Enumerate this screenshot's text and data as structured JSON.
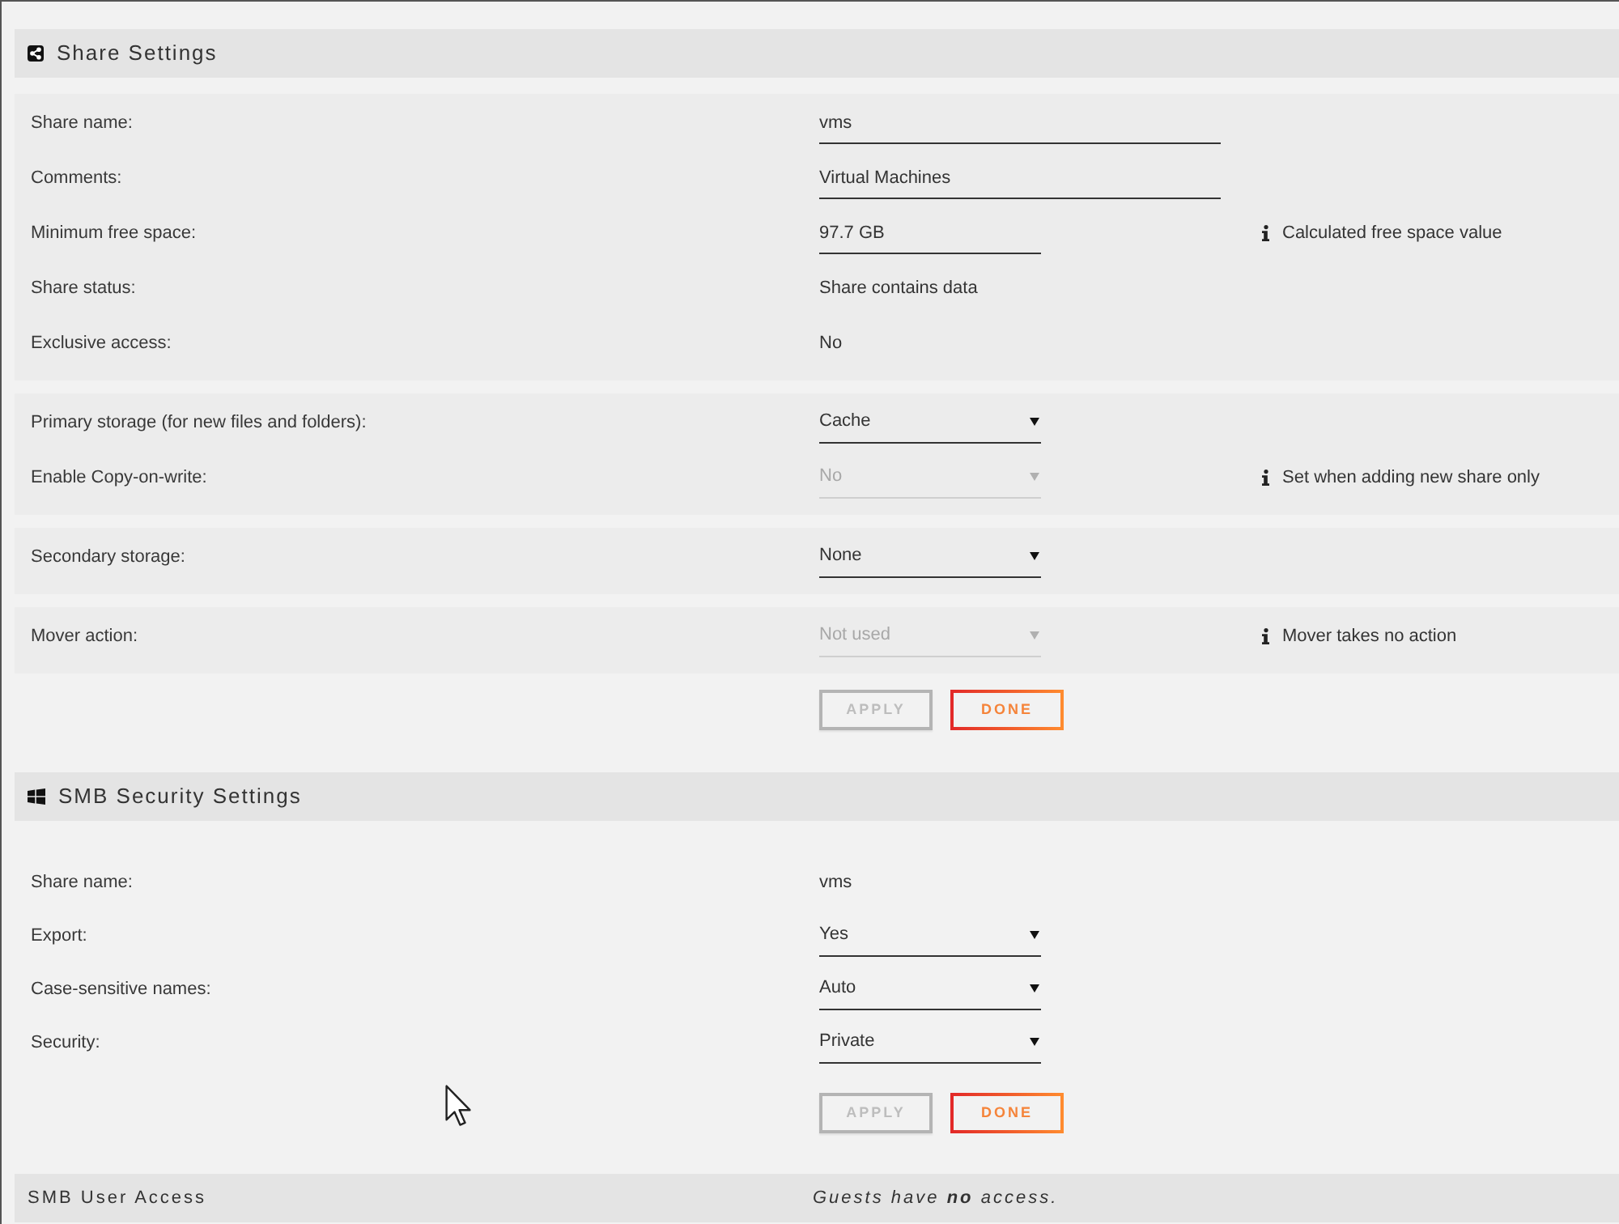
{
  "share_settings": {
    "title": "Share Settings",
    "groups": [
      {
        "rows": [
          {
            "label": "Share name:",
            "kind": "text",
            "value": "vms"
          },
          {
            "label": "Comments:",
            "kind": "text",
            "value": "Virtual Machines"
          },
          {
            "label": "Minimum free space:",
            "kind": "number",
            "value": "97.7 GB",
            "note": "Calculated free space value"
          },
          {
            "label": "Share status:",
            "kind": "static",
            "value": "Share contains data"
          },
          {
            "label": "Exclusive access:",
            "kind": "static",
            "value": "No"
          }
        ]
      },
      {
        "rows": [
          {
            "label": "Primary storage (for new files and folders):",
            "kind": "select",
            "value": "Cache",
            "disabled": false
          },
          {
            "label": "Enable Copy-on-write:",
            "kind": "select",
            "value": "No",
            "disabled": true,
            "note": "Set when adding new share only"
          }
        ]
      },
      {
        "rows": [
          {
            "label": "Secondary storage:",
            "kind": "select",
            "value": "None",
            "disabled": false
          }
        ]
      },
      {
        "rows": [
          {
            "label": "Mover action:",
            "kind": "select",
            "value": "Not used",
            "disabled": true,
            "note": "Mover takes no action"
          }
        ]
      }
    ],
    "buttons": [
      {
        "label": "APPLY",
        "disabled": true
      },
      {
        "label": "DONE",
        "disabled": false
      }
    ]
  },
  "smb_security_settings": {
    "title": "SMB Security Settings",
    "rows": [
      {
        "label": "Share name:",
        "kind": "static",
        "value": "vms"
      },
      {
        "label": "Export:",
        "kind": "select",
        "value": "Yes",
        "disabled": false
      },
      {
        "label": "Case-sensitive names:",
        "kind": "select",
        "value": "Auto",
        "disabled": false
      },
      {
        "label": "Security:",
        "kind": "select",
        "value": "Private",
        "disabled": false
      }
    ],
    "buttons": [
      {
        "label": "APPLY",
        "disabled": true
      },
      {
        "label": "DONE",
        "disabled": false
      }
    ]
  },
  "smb_user_access": {
    "title": "SMB User Access",
    "note": "Guests have **no** access."
  }
}
